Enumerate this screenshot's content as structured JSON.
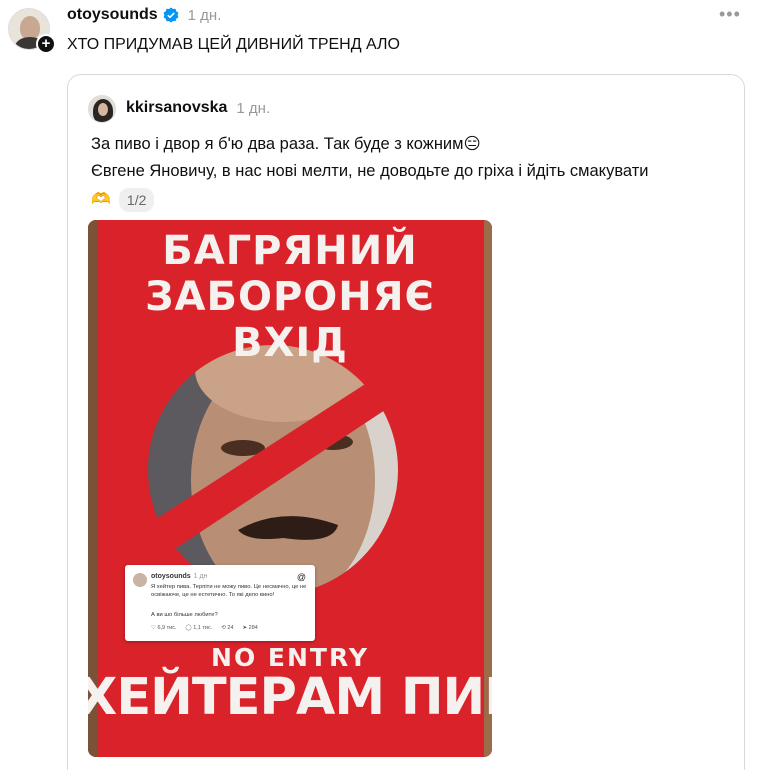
{
  "post": {
    "username": "otoysounds",
    "time": "1 дн.",
    "more_icon": "more-dots-icon",
    "text": "ХТО ПРИДУМАВ ЦЕЙ ДИВНИЙ ТРЕНД АЛО",
    "follow_badge": "+"
  },
  "quote": {
    "username": "kkirsanovska",
    "time": "1 дн.",
    "line1": "За пиво і двор я б'ю два раза. Так буде з кожним😑",
    "line2": "Євгене Яновичу, в нас нові мелти, не доводьте до гріха і йдіть смакувати",
    "line3_emoji": "🫶",
    "pager": "1/2"
  },
  "photo": {
    "headline_1": "БАГРЯНИЙ",
    "headline_2": "ЗАБОРОНЯЄ ВХІД",
    "no_entry": "NO ENTRY",
    "haters": "ХЕЙТЕРАМ ПИВА",
    "embed": {
      "username": "otoysounds",
      "time": "1 дн",
      "logo": "@",
      "body": "Я хейтер пива. Терпіти не можу пиво. Це несмачно, це не освіжаюче, це не естетично. То які дело вино!",
      "question": "А ви шо більше любите?",
      "likes": "♡ 6,9 тис.",
      "replies": "◯ 1,1 тис.",
      "reposts": "⟲ 24",
      "shares": "➤ 284"
    }
  },
  "colors": {
    "poster_red": "#d9222a",
    "muted_gray": "#999999"
  }
}
